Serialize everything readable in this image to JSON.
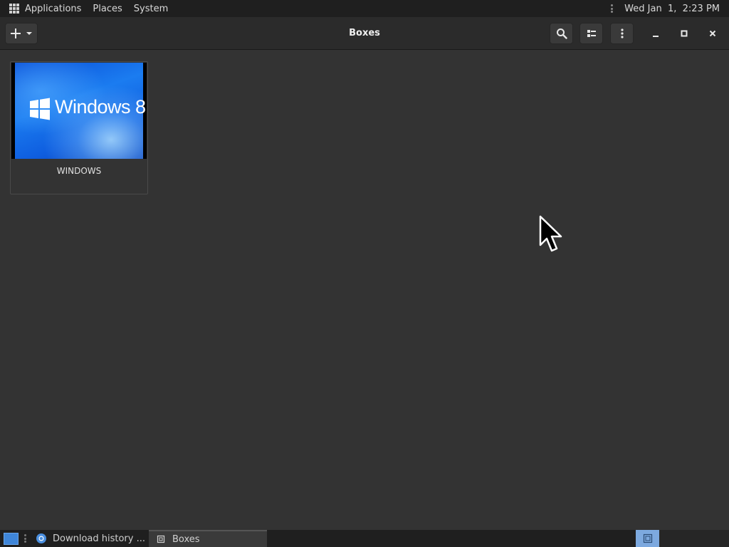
{
  "top_panel": {
    "menus": [
      "Applications",
      "Places",
      "System"
    ],
    "clock": "Wed Jan  1,  2:23 PM"
  },
  "headerbar": {
    "title": "Boxes",
    "icons": {
      "new": "plus-icon",
      "new_dropdown": "chevron-down-icon",
      "search": "search-icon",
      "view": "list-view-icon",
      "menu": "kebab-menu-icon",
      "minimize": "minimize-icon",
      "maximize": "maximize-icon",
      "close": "close-icon"
    }
  },
  "boxes": [
    {
      "name": "WINDOWS",
      "thumbnail_text": "Windows 8"
    }
  ],
  "taskbar": {
    "tasks": [
      {
        "label": "Download history ...",
        "icon": "browser-icon"
      },
      {
        "label": "Boxes",
        "icon": "boxes-app-icon",
        "active": true
      }
    ]
  },
  "colors": {
    "panel_bg": "#1f1f1f",
    "header_bg": "#2b2b2b",
    "content_bg": "#333333",
    "accent": "#3f86d9",
    "workspace_active": "#7da9df"
  }
}
